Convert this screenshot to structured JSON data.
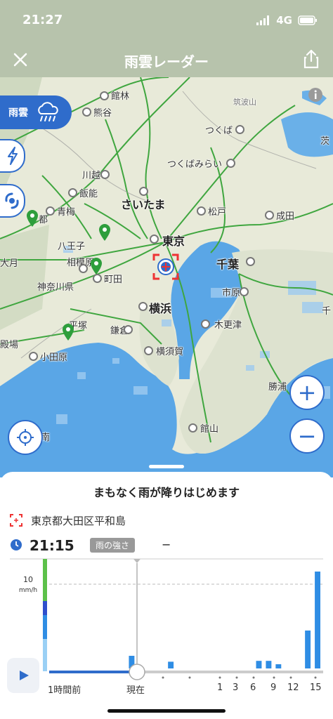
{
  "status_bar": {
    "time": "21:27",
    "network": "4G"
  },
  "header": {
    "title": "雨雲レーダー"
  },
  "map": {
    "labels": [
      {
        "text": "館林",
        "cls": ""
      },
      {
        "text": "熊谷",
        "cls": ""
      },
      {
        "text": "筑波山",
        "cls": "gray"
      },
      {
        "text": "つくば",
        "cls": ""
      },
      {
        "text": "つくばみらい",
        "cls": ""
      },
      {
        "text": "川越",
        "cls": ""
      },
      {
        "text": "飯能",
        "cls": ""
      },
      {
        "text": "さいたま",
        "cls": "big"
      },
      {
        "text": "青梅",
        "cls": ""
      },
      {
        "text": "松戸",
        "cls": ""
      },
      {
        "text": "成田",
        "cls": ""
      },
      {
        "text": "八王子",
        "cls": ""
      },
      {
        "text": "東京",
        "cls": "big"
      },
      {
        "text": "相模原",
        "cls": ""
      },
      {
        "text": "町田",
        "cls": ""
      },
      {
        "text": "千葉",
        "cls": "big"
      },
      {
        "text": "神奈川県",
        "cls": ""
      },
      {
        "text": "横浜",
        "cls": "big"
      },
      {
        "text": "市原",
        "cls": ""
      },
      {
        "text": "平塚",
        "cls": ""
      },
      {
        "text": "鎌倉",
        "cls": ""
      },
      {
        "text": "木更津",
        "cls": ""
      },
      {
        "text": "殿場",
        "cls": ""
      },
      {
        "text": "小田原",
        "cls": ""
      },
      {
        "text": "横須賀",
        "cls": ""
      },
      {
        "text": "勝浦",
        "cls": ""
      },
      {
        "text": "館山",
        "cls": ""
      },
      {
        "text": "都",
        "cls": ""
      },
      {
        "text": "茨",
        "cls": ""
      },
      {
        "text": "千",
        "cls": ""
      },
      {
        "text": "大月",
        "cls": ""
      },
      {
        "text": "南",
        "cls": ""
      }
    ],
    "rain_layer_label": "雨雲",
    "zoom_in": "+",
    "zoom_out": "−"
  },
  "sheet": {
    "title": "まもなく雨が降りはじめます",
    "location": "東京都大田区平和島",
    "time": "21:15",
    "intensity_badge": "雨の強さ",
    "intensity_value": "−"
  },
  "chart_data": {
    "type": "bar",
    "ylabel": "mm/h",
    "yticks": [
      10
    ],
    "ylim": [
      0,
      13
    ],
    "x_labels": [
      "1時間前",
      "現在",
      "1",
      "3",
      "6",
      "9",
      "12",
      "15"
    ],
    "values": [
      0,
      0,
      0,
      0,
      0,
      0,
      0,
      0,
      1.5,
      0,
      0,
      0,
      0.8,
      0,
      0,
      0,
      0,
      0,
      0,
      0,
      0,
      0.9,
      0.9,
      0.5,
      0,
      0,
      4.5,
      11.5
    ],
    "colors": {
      "bar": "#2f8de4",
      "current_line": "#888888",
      "dashed": "#bbbbbb"
    }
  },
  "colors": {
    "accent": "#2f6ccb",
    "header": "#b7c3ac",
    "sea": "#5aa6e6",
    "land": "#e8ead9",
    "road": "#3fa63f"
  }
}
